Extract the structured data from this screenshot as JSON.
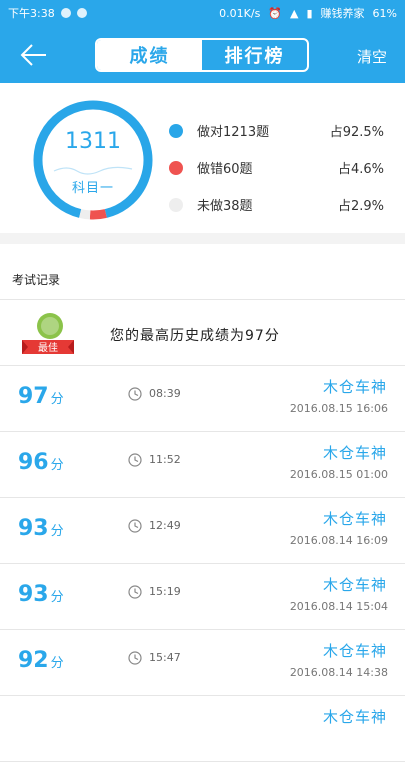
{
  "status_bar": {
    "time": "下午3:38",
    "speed": "0.01K/s",
    "carrier": "赚钱养家",
    "battery": "61%"
  },
  "header": {
    "tabs": [
      {
        "label": "成绩",
        "active": true
      },
      {
        "label": "排行榜",
        "active": false
      }
    ],
    "clear_label": "清空"
  },
  "summary": {
    "total": "1311",
    "subject": "科目一",
    "legend": [
      {
        "label": "做对1213题",
        "pct": "占92.5%",
        "color": "#29a6e8"
      },
      {
        "label": "做错60题",
        "pct": "占4.6%",
        "color": "#ef5350"
      },
      {
        "label": "未做38题",
        "pct": "占2.9%",
        "color": "#eeeeee"
      }
    ]
  },
  "records": {
    "heading": "考试记录",
    "best_badge": "最佳",
    "best_text": "您的最高历史成绩为97分",
    "unit": "分",
    "items": [
      {
        "score": "97",
        "duration": "08:39",
        "user": "木仓车神",
        "datetime": "2016.08.15  16:06"
      },
      {
        "score": "96",
        "duration": "11:52",
        "user": "木仓车神",
        "datetime": "2016.08.15  01:00"
      },
      {
        "score": "93",
        "duration": "12:49",
        "user": "木仓车神",
        "datetime": "2016.08.14  16:09"
      },
      {
        "score": "93",
        "duration": "15:19",
        "user": "木仓车神",
        "datetime": "2016.08.14  15:04"
      },
      {
        "score": "92",
        "duration": "15:47",
        "user": "木仓车神",
        "datetime": "2016.08.14  14:38"
      },
      {
        "score": "",
        "duration": "",
        "user": "木仓车神",
        "datetime": ""
      }
    ]
  }
}
